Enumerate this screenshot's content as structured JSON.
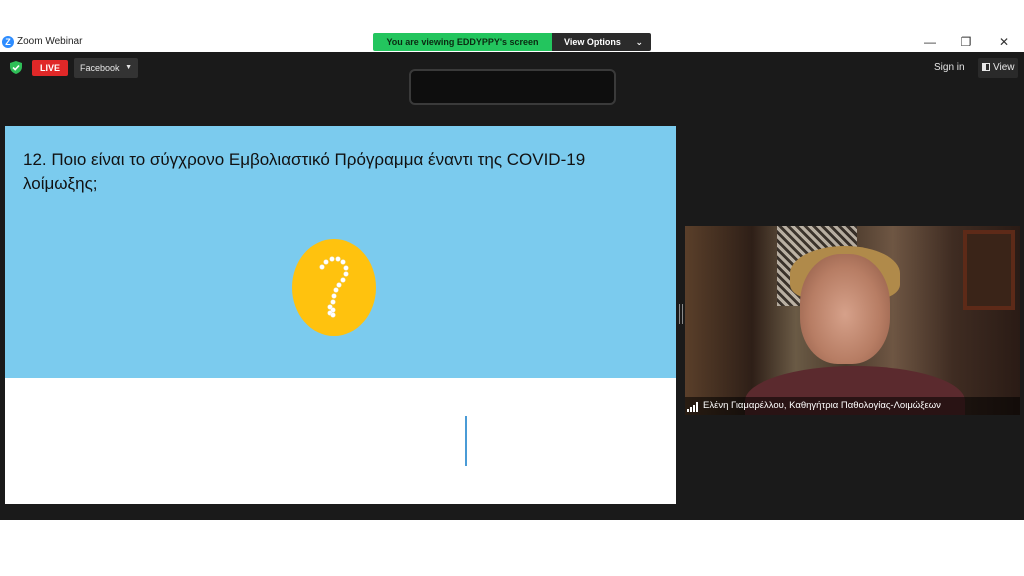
{
  "window": {
    "app_logo": "Z",
    "title": "Zoom Webinar",
    "minimize_glyph": "—",
    "maximize_glyph": "❐",
    "close_glyph": "✕"
  },
  "banner": {
    "viewing_text": "You are viewing EDDYPPY's screen",
    "view_options_label": "View Options",
    "chevron_glyph": "⌄"
  },
  "toolbar": {
    "live_label": "LIVE",
    "stream_target_label": "Facebook",
    "caret_glyph": "▼",
    "sign_in_label": "Sign in",
    "view_label": "View"
  },
  "slide": {
    "title": "12. Ποιο είναι το σύγχρονο Εμβολιαστικό Πρόγραμμα έναντι της COVID-19 λοίμωξης;"
  },
  "video": {
    "participant_name": "Ελένη Γιαμαρέλλου, Καθηγήτρια Παθολογίας-Λοιμώξεων"
  },
  "colors": {
    "banner_green": "#23c55e",
    "live_red": "#e02828",
    "slide_blue": "#7bcbee",
    "question_yellow": "#ffc20e",
    "meeting_bg": "#1a1a1a"
  },
  "icons": {
    "app": "zoom-logo-icon",
    "security": "shield-check-icon",
    "question": "question-mark-icon",
    "signal": "signal-strength-icon",
    "view": "view-layout-icon"
  }
}
